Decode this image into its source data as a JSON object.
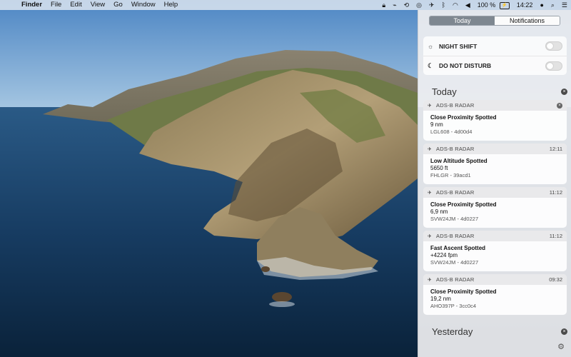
{
  "menubar": {
    "app_name": "Finder",
    "menus": [
      "File",
      "Edit",
      "View",
      "Go",
      "Window",
      "Help"
    ],
    "status_icons": [
      "lock-icon",
      "wifi-app-icon",
      "time-machine-icon",
      "clipboard-icon",
      "radar-icon",
      "bluetooth-icon",
      "wifi-icon",
      "volume-icon"
    ],
    "battery_percent": "100 %",
    "clock": "14:22",
    "right_icons": [
      "user-icon",
      "spotlight-icon",
      "notification-center-icon"
    ]
  },
  "notification_center": {
    "tabs": [
      {
        "label": "Today",
        "active": true
      },
      {
        "label": "Notifications",
        "active": false
      }
    ],
    "toggles": [
      {
        "label": "NIGHT SHIFT",
        "icon": "sun-icon",
        "on": false
      },
      {
        "label": "DO NOT DISTURB",
        "icon": "moon-icon",
        "on": false
      }
    ],
    "sections": [
      {
        "title": "Today"
      },
      {
        "title": "Yesterday"
      }
    ],
    "notifications": [
      {
        "app": "ADS-B RADAR",
        "time": "",
        "title": "Close Proximity Spotted",
        "detail": "9 nm",
        "meta": "LGL608 - 4d00d4"
      },
      {
        "app": "ADS-B RADAR",
        "time": "12:11",
        "title": "Low Altitude Spotted",
        "detail": "5650 ft",
        "meta": "FHLGR - 39acd1"
      },
      {
        "app": "ADS-B RADAR",
        "time": "11:12",
        "title": "Close Proximity Spotted",
        "detail": "6,9 nm",
        "meta": "SVW24JM - 4d0227"
      },
      {
        "app": "ADS-B RADAR",
        "time": "11:12",
        "title": "Fast Ascent Spotted",
        "detail": "+4224 fpm",
        "meta": "SVW24JM - 4d0227"
      },
      {
        "app": "ADS-B RADAR",
        "time": "09:32",
        "title": "Close Proximity Spotted",
        "detail": "19,2 nm",
        "meta": "AHO397P - 3cc0c4"
      }
    ]
  }
}
